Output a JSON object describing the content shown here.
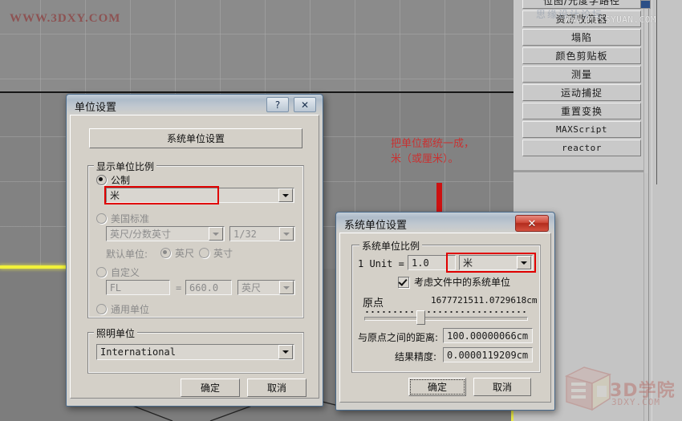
{
  "viewport": {
    "watermark_top_left": "WWW.3DXY.COM"
  },
  "command_panel": {
    "watermark_forum": "思缘设计论坛",
    "watermark_site": "WWW.MISSYUAN.COM",
    "buttons": [
      {
        "label": "位图/光度学路径",
        "mono": false
      },
      {
        "label": "资源收集器",
        "mono": false
      },
      {
        "label": "塌陷",
        "mono": false
      },
      {
        "label": "颜色剪贴板",
        "mono": false
      },
      {
        "label": "测量",
        "mono": false
      },
      {
        "label": "运动捕捉",
        "mono": false
      },
      {
        "label": "重置变换",
        "mono": false
      },
      {
        "label": "MAXScript",
        "mono": true
      },
      {
        "label": "reactor",
        "mono": true
      }
    ]
  },
  "annotation": {
    "text": "把单位都统一成，\n米（或厘米）。",
    "color": "#c83232"
  },
  "units_dialog": {
    "title": "单位设置",
    "help_button": "?",
    "close_button": "✕",
    "system_unit_setup_button": "系统单位设置",
    "display_scale_group": "显示单位比例",
    "metric": {
      "label": "公制",
      "selected": true,
      "value": "米",
      "highlighted": true
    },
    "us_standard": {
      "label": "美国标准",
      "selected": false,
      "value": "英尺/分数英寸",
      "fraction": "1/32",
      "default_units_label": "默认单位:",
      "default_feet": "英尺",
      "default_inches": "英寸",
      "default_selected": "英尺"
    },
    "custom": {
      "label": "自定义",
      "selected": false,
      "name": "FL",
      "equals": "=",
      "value": "660.0",
      "unit": "英尺"
    },
    "generic": {
      "label": "通用单位",
      "selected": false
    },
    "lighting_group": "照明单位",
    "lighting_value": "International",
    "ok": "确定",
    "cancel": "取消"
  },
  "system_units_dialog": {
    "title": "系统单位设置",
    "close_button": "✕",
    "scale_group": "系统单位比例",
    "unit_label": "1 Unit =",
    "unit_value": "1.0",
    "unit_type": "米",
    "unit_type_highlighted": true,
    "respect_file_units": "考虑文件中的系统单位",
    "respect_file_units_checked": true,
    "origin_label": "原点",
    "origin_value": "1677721511.0729618cm",
    "distance_label": "与原点之间的距离:",
    "distance_value": "100.00000066cm",
    "accuracy_label": "结果精度:",
    "accuracy_value": "0.0000119209cm",
    "ok": "确定",
    "cancel": "取消"
  },
  "watermark_logo": {
    "cn": "3D学院",
    "domain": "3DXY.COM"
  }
}
